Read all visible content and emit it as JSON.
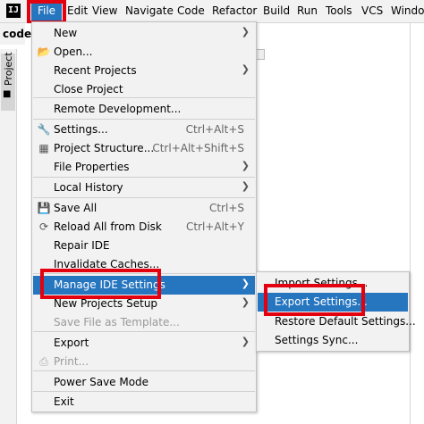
{
  "app": {
    "logo": "IJ",
    "project_name": "code"
  },
  "menubar": {
    "items": [
      "File",
      "Edit",
      "View",
      "Navigate",
      "Code",
      "Refactor",
      "Build",
      "Run",
      "Tools",
      "VCS",
      "Window"
    ]
  },
  "project_tool": {
    "label": "Project"
  },
  "file_menu": {
    "new": "New",
    "open": "Open...",
    "recent_projects": "Recent Projects",
    "close_project": "Close Project",
    "remote_development": "Remote Development...",
    "settings": "Settings...",
    "settings_shortcut": "Ctrl+Alt+S",
    "project_structure": "Project Structure...",
    "project_structure_shortcut": "Ctrl+Alt+Shift+S",
    "file_properties": "File Properties",
    "local_history": "Local History",
    "save_all": "Save All",
    "save_all_shortcut": "Ctrl+S",
    "reload_all": "Reload All from Disk",
    "reload_all_shortcut": "Ctrl+Alt+Y",
    "repair_ide": "Repair IDE",
    "invalidate_caches": "Invalidate Caches...",
    "manage_ide_settings": "Manage IDE Settings",
    "new_projects_setup": "New Projects Setup",
    "save_file_as_template": "Save File as Template...",
    "export": "Export",
    "print": "Print...",
    "power_save_mode": "Power Save Mode",
    "exit": "Exit"
  },
  "manage_submenu": {
    "import_settings": "Import Settings...",
    "export_settings": "Export Settings...",
    "restore_defaults": "Restore Default Settings...",
    "settings_sync": "Settings Sync..."
  },
  "colors": {
    "selection": "#2675bf",
    "highlight_box": "#e3000f",
    "menu_bg": "#f2f2f2"
  }
}
